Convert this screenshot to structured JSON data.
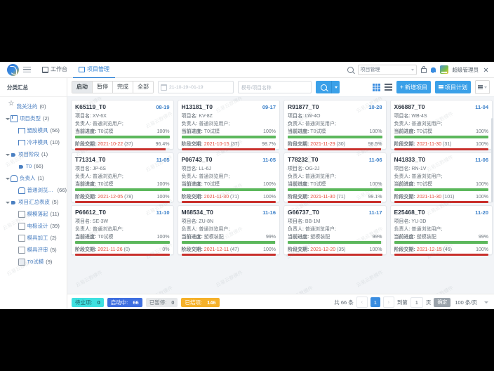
{
  "header": {
    "logo_icon": "app-logo-icon",
    "menu_icon": "hamburger-icon",
    "nav": [
      {
        "label": "工作台",
        "icon": "monitor-icon",
        "active": false
      },
      {
        "label": "项目管理",
        "icon": "grid-icon",
        "active": true
      }
    ],
    "search_icon": "search-icon",
    "module_select_value": "项目管理",
    "lock_icon": "lock-icon",
    "bell_icon": "bell-icon",
    "avatar_icon": "user-avatar",
    "username": "超级管理员",
    "expand_icon": "fullscreen-icon"
  },
  "sidebar": {
    "title": "分类汇总",
    "items": [
      {
        "label": "我关注的",
        "count": "(0)",
        "icon": "star-icon",
        "indent": 0,
        "arrow": "none"
      },
      {
        "label": "项目类型",
        "count": "(2)",
        "icon": "grid-icon",
        "indent": 0,
        "arrow": "open"
      },
      {
        "label": "塑胶模具",
        "count": "(56)",
        "icon": "bookmark-icon",
        "indent": 2,
        "arrow": "none"
      },
      {
        "label": "冷冲模具",
        "count": "(10)",
        "icon": "bookmark-icon",
        "indent": 2,
        "arrow": "none"
      },
      {
        "label": "项目阶段",
        "count": "(1)",
        "icon": "tag-icon",
        "indent": 0,
        "arrow": "open"
      },
      {
        "label": "T0",
        "count": "(66)",
        "icon": "tag-icon",
        "indent": 2,
        "arrow": "none"
      },
      {
        "label": "负责人",
        "count": "(1)",
        "icon": "person-icon",
        "indent": 0,
        "arrow": "open"
      },
      {
        "label": "普通浏览用户",
        "count": "(66)",
        "icon": "person-icon",
        "indent": 2,
        "arrow": "none"
      },
      {
        "label": "项目汇总表皮",
        "count": "(5)",
        "icon": "tag-icon",
        "indent": 0,
        "arrow": "open"
      },
      {
        "label": "模模落起",
        "count": "(11)",
        "icon": "doc-icon",
        "indent": 2,
        "arrow": "none"
      },
      {
        "label": "电极设计",
        "count": "(39)",
        "icon": "doc-icon",
        "indent": 2,
        "arrow": "none"
      },
      {
        "label": "模具加工",
        "count": "(2)",
        "icon": "doc-icon",
        "indent": 2,
        "arrow": "none"
      },
      {
        "label": "模具评审",
        "count": "(5)",
        "icon": "doc-icon",
        "indent": 2,
        "arrow": "none"
      },
      {
        "label": "T0试模",
        "count": "(9)",
        "icon": "doc-page-icon",
        "indent": 2,
        "arrow": "none"
      }
    ]
  },
  "toolbar": {
    "segments": [
      {
        "label": "启动",
        "active": true
      },
      {
        "label": "暂停",
        "active": false
      },
      {
        "label": "完成",
        "active": false
      },
      {
        "label": "全部",
        "active": false
      }
    ],
    "date_range_value": "21-10-19~01-19",
    "calendar_icon": "calendar-icon",
    "keyword_placeholder": "模号/项目名称",
    "search_button_icon": "search-icon",
    "search_dropdown_icon": "chevron-down-icon",
    "grid_view_icon": "grid-view-icon",
    "list_view_icon": "list-view-icon",
    "new_project_label": "新增项目",
    "new_project_icon": "plus-icon",
    "project_plan_label": "项目计划",
    "project_plan_icon": "bars-icon",
    "more_menu_icon": "menu-icon"
  },
  "card_labels": {
    "project_name": "项目名:",
    "owner": "负责人:",
    "progress": "当前进度:",
    "deadline": "阶段交期:"
  },
  "cards": [
    {
      "no": "K65119_T0",
      "date": "08-19",
      "name": "XV-6X",
      "owner": "普通浏览用户;",
      "stage": "T0试模",
      "stage_pct": "100%",
      "stage_bar": 100,
      "deadline": "2021-10-22",
      "deadline_days": "(37)",
      "deadline_pct": "96.4%",
      "deadline_bar": 96
    },
    {
      "no": "H13181_T0",
      "date": "09-17",
      "name": "KV-8Z",
      "owner": "普通浏览用户;",
      "stage": "T0试模",
      "stage_pct": "100%",
      "stage_bar": 100,
      "deadline": "2021-10-15",
      "deadline_days": "(37)",
      "deadline_pct": "98.7%",
      "deadline_bar": 99
    },
    {
      "no": "R91877_T0",
      "date": "10-28",
      "name": "LW-4O",
      "owner": "普通浏览用户;",
      "stage": "T0试模",
      "stage_pct": "100%",
      "stage_bar": 100,
      "deadline": "2021-11-29",
      "deadline_days": "(30)",
      "deadline_pct": "98.5%",
      "deadline_bar": 99
    },
    {
      "no": "X66887_T0",
      "date": "11-04",
      "name": "WB-4S",
      "owner": "普通浏览用户;",
      "stage": "T0试模",
      "stage_pct": "100%",
      "stage_bar": 100,
      "deadline": "2021-11-30",
      "deadline_days": "(31)",
      "deadline_pct": "100%",
      "deadline_bar": 100
    },
    {
      "no": "T71314_T0",
      "date": "11-05",
      "name": "JP-6S",
      "owner": "普通浏览用户;",
      "stage": "T0试模",
      "stage_pct": "100%",
      "stage_bar": 100,
      "deadline": "2021-12-05",
      "deadline_days": "(78)",
      "deadline_pct": "100%",
      "deadline_bar": 100
    },
    {
      "no": "P06743_T0",
      "date": "11-05",
      "name": "LL-6J",
      "owner": "普通浏览用户;",
      "stage": "T0试模",
      "stage_pct": "100%",
      "stage_bar": 100,
      "deadline": "2021-11-30",
      "deadline_days": "(71)",
      "deadline_pct": "100%",
      "deadline_bar": 100
    },
    {
      "no": "T78232_T0",
      "date": "11-06",
      "name": "OG-2J",
      "owner": "普通浏览用户;",
      "stage": "T0试模",
      "stage_pct": "100%",
      "stage_bar": 100,
      "deadline": "2021-11-30",
      "deadline_days": "(71)",
      "deadline_pct": "99.1%",
      "deadline_bar": 99
    },
    {
      "no": "N41833_T0",
      "date": "11-06",
      "name": "RN-1V",
      "owner": "普通浏览用户;",
      "stage": "T0试模",
      "stage_pct": "100%",
      "stage_bar": 100,
      "deadline": "2021-11-30",
      "deadline_days": "(101)",
      "deadline_pct": "100%",
      "deadline_bar": 100
    },
    {
      "no": "P66612_T0",
      "date": "11-10",
      "name": "SE-3W",
      "owner": "普通浏览用户;",
      "stage": "T0试模",
      "stage_pct": "100%",
      "stage_bar": 100,
      "deadline": "2021-11-26",
      "deadline_days": "(0)",
      "deadline_pct": "0%",
      "deadline_bar": 100
    },
    {
      "no": "M68534_T0",
      "date": "11-16",
      "name": "ZU-8N",
      "owner": "普通浏览用户;",
      "stage": "塑模装配",
      "stage_pct": "99%",
      "stage_bar": 99,
      "deadline": "2021-12-11",
      "deadline_days": "(47)",
      "deadline_pct": "100%",
      "deadline_bar": 100
    },
    {
      "no": "G66737_T0",
      "date": "11-17",
      "name": "BB-1M",
      "owner": "普通浏览用户;",
      "stage": "塑模装配",
      "stage_pct": "99%",
      "stage_bar": 99,
      "deadline": "2021-12-20",
      "deadline_days": "(35)",
      "deadline_pct": "100%",
      "deadline_bar": 100
    },
    {
      "no": "E25468_T0",
      "date": "11-20",
      "name": "YU-3D",
      "owner": "普通浏览用户;",
      "stage": "塑模装配",
      "stage_pct": "99%",
      "stage_bar": 99,
      "deadline": "2021-12-15",
      "deadline_days": "(46)",
      "deadline_pct": "100%",
      "deadline_bar": 100
    }
  ],
  "footer": {
    "badges": [
      {
        "label": "待立项:",
        "count": "0",
        "color": "#3fe0e0"
      },
      {
        "label": "启动中:",
        "count": "66",
        "color": "#3f6fe0"
      },
      {
        "label": "已暂停:",
        "count": "0",
        "color": "#e6e8ea"
      },
      {
        "label": "已结项:",
        "count": "146",
        "color": "#f5b12a"
      }
    ],
    "total_text": "共 66 条",
    "prev_icon": "chevron-left-icon",
    "next_icon": "chevron-right-icon",
    "current_page": "1",
    "jump_label": "到第",
    "jump_value": "1",
    "page_unit": "页",
    "confirm_label": "确定",
    "page_size": "100 条/页",
    "page_size_caret": "chevron-down-icon"
  },
  "watermark": "云易云数模件"
}
